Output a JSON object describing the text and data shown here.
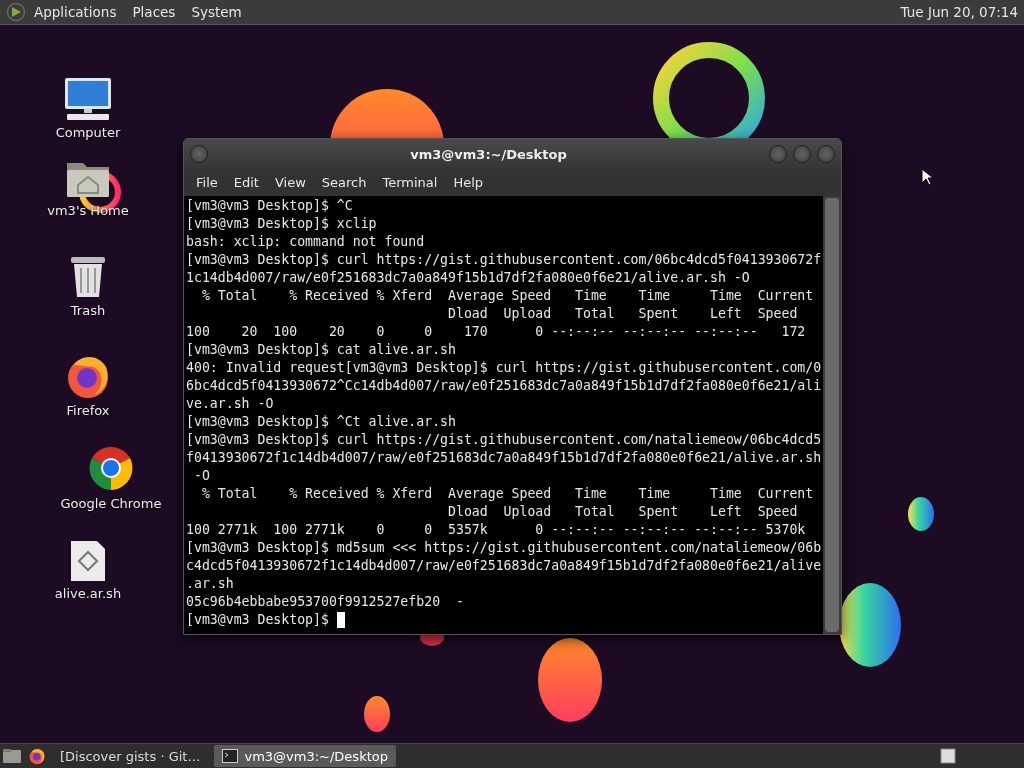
{
  "top_panel": {
    "menus": [
      "Applications",
      "Places",
      "System"
    ],
    "clock": "Tue Jun 20, 07:14"
  },
  "desktop_icons": [
    {
      "label": "Computer",
      "kind": "computer"
    },
    {
      "label": "vm3's Home",
      "kind": "home"
    },
    {
      "label": "Trash",
      "kind": "trash"
    },
    {
      "label": "Firefox",
      "kind": "firefox"
    },
    {
      "label": "Google Chrome",
      "kind": "chrome"
    },
    {
      "label": "alive.ar.sh",
      "kind": "script"
    }
  ],
  "terminal": {
    "title": "vm3@vm3:~/Desktop",
    "menus": [
      "File",
      "Edit",
      "View",
      "Search",
      "Terminal",
      "Help"
    ],
    "lines": [
      "[vm3@vm3 Desktop]$ ^C",
      "[vm3@vm3 Desktop]$ xclip",
      "bash: xclip: command not found",
      "[vm3@vm3 Desktop]$ curl https://gist.githubusercontent.com/06bc4dcd5f0413930672f",
      "1c14db4d007/raw/e0f251683dc7a0a849f15b1d7df2fa080e0f6e21/alive.ar.sh -O",
      "  % Total    % Received % Xferd  Average Speed   Time    Time     Time  Current",
      "                                 Dload  Upload   Total   Spent    Left  Speed",
      "100    20  100    20    0     0    170      0 --:--:-- --:--:-- --:--:--   172",
      "[vm3@vm3 Desktop]$ cat alive.ar.sh",
      "400: Invalid request[vm3@vm3 Desktop]$ curl https://gist.githubusercontent.com/0",
      "6bc4dcd5f0413930672^Cc14db4d007/raw/e0f251683dc7a0a849f15b1d7df2fa080e0f6e21/ali",
      "ve.ar.sh -O",
      "[vm3@vm3 Desktop]$ ^Ct alive.ar.sh",
      "[vm3@vm3 Desktop]$ curl https://gist.githubusercontent.com/nataliemeow/06bc4dcd5",
      "f0413930672f1c14db4d007/raw/e0f251683dc7a0a849f15b1d7df2fa080e0f6e21/alive.ar.sh",
      " -O",
      "  % Total    % Received % Xferd  Average Speed   Time    Time     Time  Current",
      "                                 Dload  Upload   Total   Spent    Left  Speed",
      "100 2771k  100 2771k    0     0  5357k      0 --:--:-- --:--:-- --:--:-- 5370k",
      "[vm3@vm3 Desktop]$ md5sum <<< https://gist.githubusercontent.com/nataliemeow/06b",
      "c4dcd5f0413930672f1c14db4d007/raw/e0f251683dc7a0a849f15b1d7df2fa080e0f6e21/alive",
      ".ar.sh",
      "05c96b4ebbabe953700f9912527efb20  -",
      "[vm3@vm3 Desktop]$"
    ]
  },
  "taskbar": {
    "items": [
      {
        "label": "[Discover gists · Git…",
        "kind": "browser",
        "selected": false
      },
      {
        "label": "vm3@vm3:~/Desktop",
        "kind": "terminal",
        "selected": true
      }
    ]
  }
}
